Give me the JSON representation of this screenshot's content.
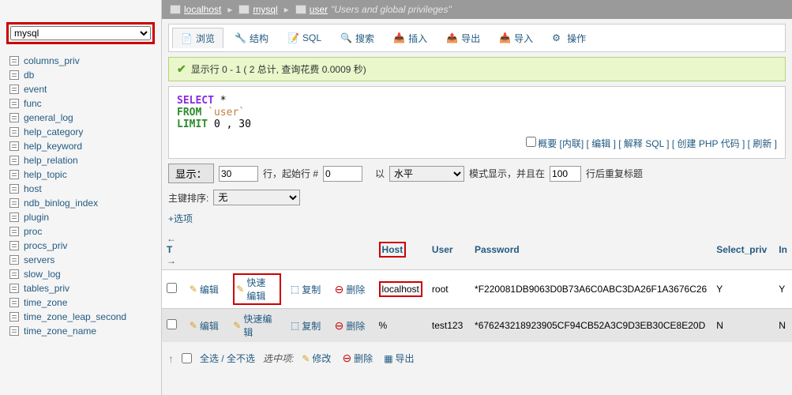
{
  "sidebar": {
    "selected_db": "mysql",
    "tables": [
      "columns_priv",
      "db",
      "event",
      "func",
      "general_log",
      "help_category",
      "help_keyword",
      "help_relation",
      "help_topic",
      "host",
      "ndb_binlog_index",
      "plugin",
      "proc",
      "procs_priv",
      "servers",
      "slow_log",
      "tables_priv",
      "time_zone",
      "time_zone_leap_second",
      "time_zone_name"
    ]
  },
  "breadcrumb": {
    "host": "localhost",
    "db": "mysql",
    "table": "user",
    "desc": "\"Users and global privileges\""
  },
  "tabs": {
    "items": [
      "浏览",
      "结构",
      "SQL",
      "搜索",
      "插入",
      "导出",
      "导入",
      "操作"
    ]
  },
  "status": {
    "text": "显示行 0 - 1 ( 2 总计, 查询花费 0.0009 秒)"
  },
  "sql": {
    "select": "SELECT",
    "star": " *",
    "from": "FROM",
    "table": "`user`",
    "limit": "LIMIT",
    "range": "0 , 30",
    "links": {
      "summary": "概要",
      "inline": "内联",
      "edit": "编辑",
      "explain": "解释 SQL",
      "create_php": "创建 PHP 代码",
      "refresh": "刷新"
    }
  },
  "controls": {
    "show_label": "显示：",
    "show_val": "30",
    "rows_label": "行，起始行 #",
    "start_val": "0",
    "mode_prefix": "以",
    "mode_val": "水平",
    "mode_suffix": "模式显示，并且在",
    "repeat_val": "100",
    "repeat_suffix": "行后重复标题",
    "pk_label": "主键排序:",
    "pk_val": "无",
    "options": "+选项"
  },
  "table": {
    "headers": {
      "host": "Host",
      "user": "User",
      "password": "Password",
      "select_priv": "Select_priv",
      "in": "In"
    },
    "actions": {
      "edit": "编辑",
      "quick": "快速编辑",
      "copy": "复制",
      "delete": "删除"
    },
    "rows": [
      {
        "host": "localhost",
        "user": "root",
        "password": "*F220081DB9063D0B73A6C0ABC3DA26F1A3676C26",
        "select": "Y",
        "in": "Y"
      },
      {
        "host": "%",
        "user": "test123",
        "password": "*676243218923905CF94CB52A3C9D3EB30CE8E20D",
        "select": "N",
        "in": "N"
      }
    ]
  },
  "footer": {
    "select_all": "全选 / 全不选",
    "with_selected": "选中项:",
    "edit": "修改",
    "delete": "删除",
    "export": "导出"
  }
}
